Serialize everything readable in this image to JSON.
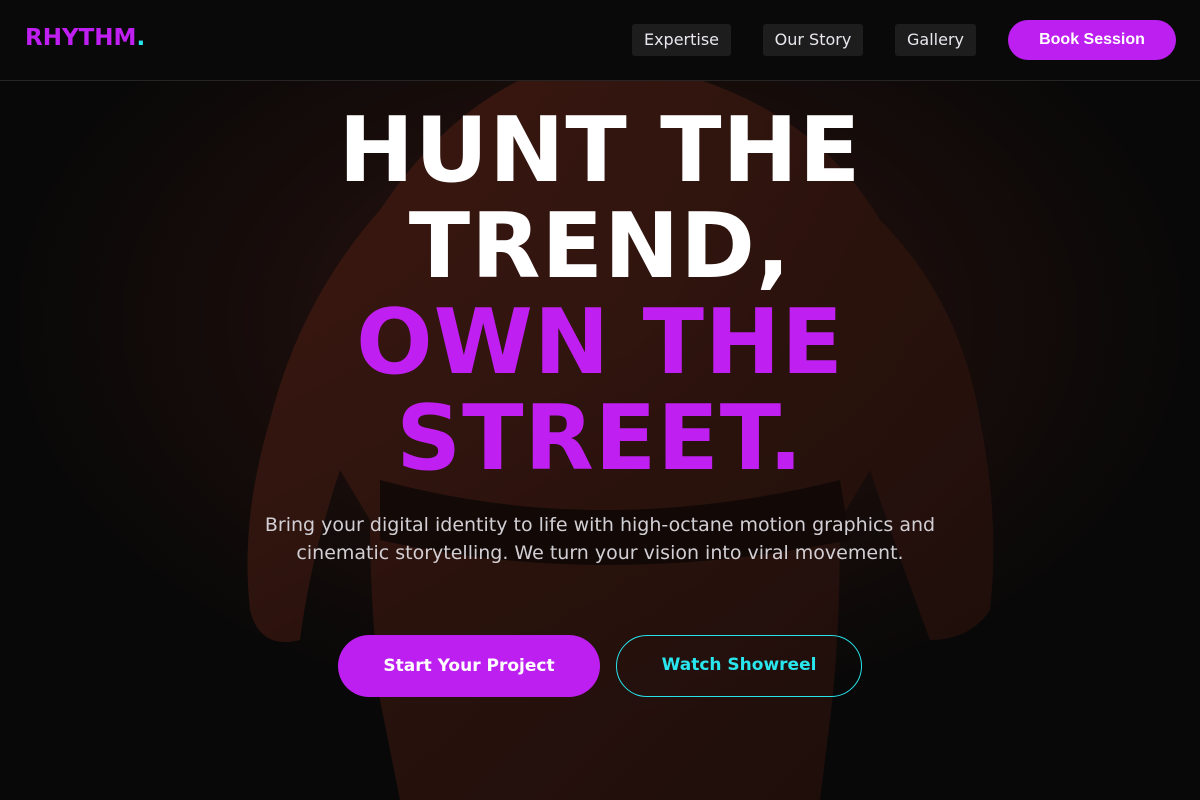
{
  "nav": {
    "logo_text": "RHYTHM",
    "logo_dot": ".",
    "links": [
      {
        "label": "Expertise"
      },
      {
        "label": "Our Story"
      },
      {
        "label": "Gallery"
      }
    ],
    "cta_label": "Book Session"
  },
  "hero": {
    "headline_line1": "HUNT THE",
    "headline_line2": "TREND,",
    "headline_line3": "OWN THE",
    "headline_line4": "STREET.",
    "subtitle": "Bring your digital identity to life with high-octane motion graphics and cinematic storytelling. We turn your vision into viral movement.",
    "primary_button": "Start Your Project",
    "secondary_button": "Watch Showreel"
  },
  "colors": {
    "accent_purple": "#bf1ff0",
    "accent_cyan": "#29e6ee",
    "background": "#0c0b0b"
  }
}
